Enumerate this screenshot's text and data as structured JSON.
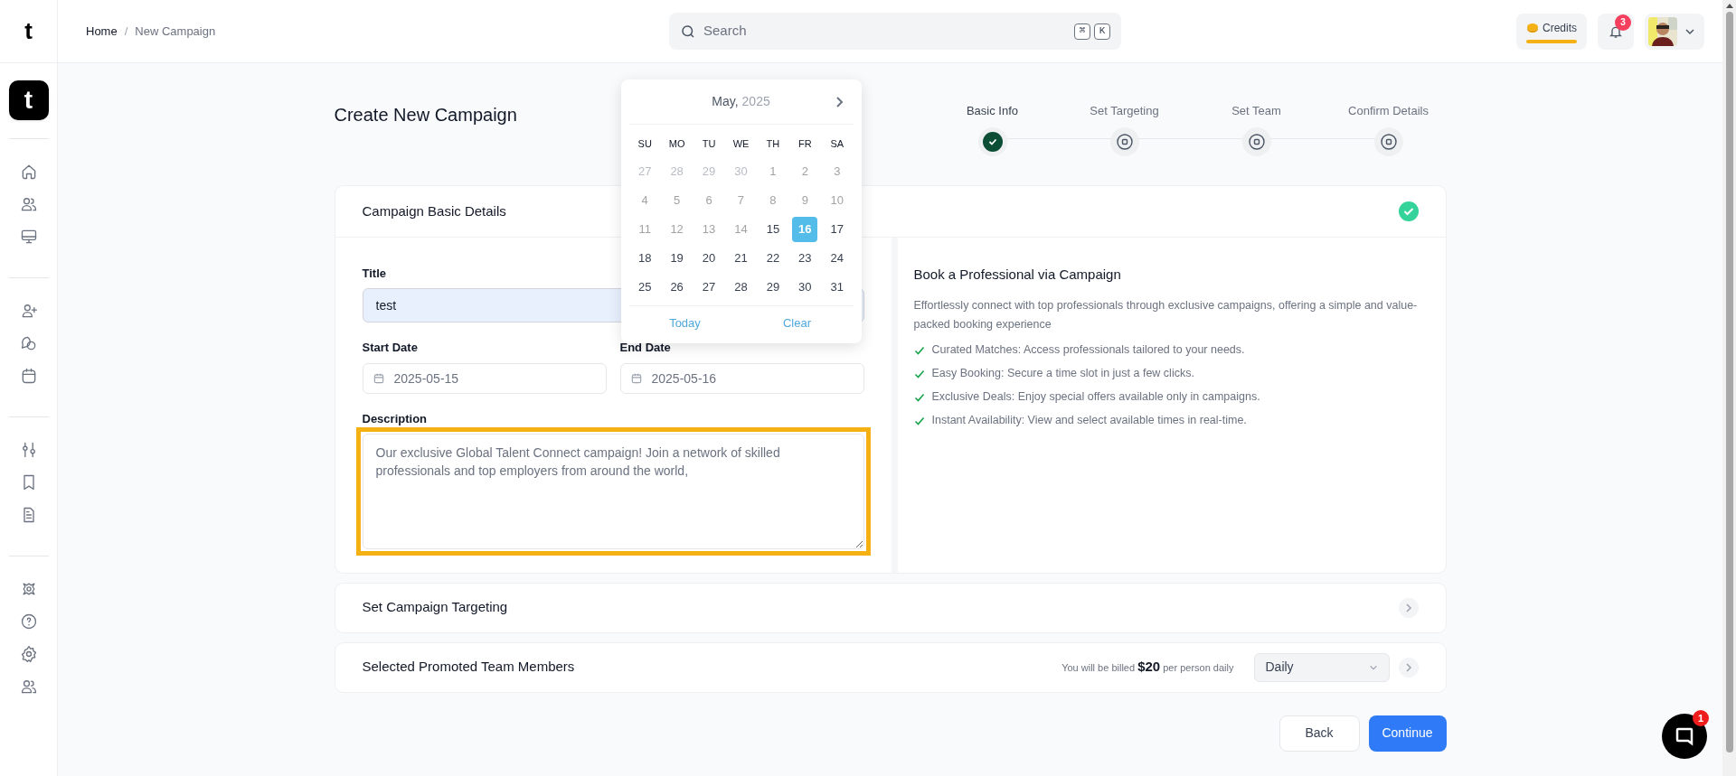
{
  "brand": {
    "logo_letter": "t",
    "app_letter": "t"
  },
  "breadcrumb": [
    {
      "label": "Home"
    },
    {
      "label": "New Campaign"
    }
  ],
  "breadcrumb_separator": "/",
  "search": {
    "placeholder": "Search",
    "keys": [
      "⌘",
      "K"
    ]
  },
  "credits": {
    "label": "Credits"
  },
  "notifications": {
    "count": "3"
  },
  "page_title": "Create New Campaign",
  "steps": [
    {
      "label": "Basic Info",
      "done": true
    },
    {
      "label": "Set Targeting",
      "done": false
    },
    {
      "label": "Set Team",
      "done": false
    },
    {
      "label": "Confirm Details",
      "done": false
    }
  ],
  "calendar": {
    "month": "May,",
    "year": "2025",
    "weekdays": [
      "SU",
      "MO",
      "TU",
      "WE",
      "TH",
      "FR",
      "SA"
    ],
    "days": [
      {
        "label": "27",
        "kind": "outside",
        "selected": false
      },
      {
        "label": "28",
        "kind": "outside",
        "selected": false
      },
      {
        "label": "29",
        "kind": "outside",
        "selected": false
      },
      {
        "label": "30",
        "kind": "outside",
        "selected": false
      },
      {
        "label": "1",
        "kind": "disabled",
        "selected": false
      },
      {
        "label": "2",
        "kind": "disabled",
        "selected": false
      },
      {
        "label": "3",
        "kind": "disabled",
        "selected": false
      },
      {
        "label": "4",
        "kind": "disabled",
        "selected": false
      },
      {
        "label": "5",
        "kind": "disabled",
        "selected": false
      },
      {
        "label": "6",
        "kind": "disabled",
        "selected": false
      },
      {
        "label": "7",
        "kind": "disabled",
        "selected": false
      },
      {
        "label": "8",
        "kind": "disabled",
        "selected": false
      },
      {
        "label": "9",
        "kind": "disabled",
        "selected": false
      },
      {
        "label": "10",
        "kind": "disabled",
        "selected": false
      },
      {
        "label": "11",
        "kind": "disabled",
        "selected": false
      },
      {
        "label": "12",
        "kind": "disabled",
        "selected": false
      },
      {
        "label": "13",
        "kind": "disabled",
        "selected": false
      },
      {
        "label": "14",
        "kind": "disabled",
        "selected": false
      },
      {
        "label": "15",
        "kind": "available",
        "selected": false
      },
      {
        "label": "16",
        "kind": "available",
        "selected": true
      },
      {
        "label": "17",
        "kind": "available",
        "selected": false
      },
      {
        "label": "18",
        "kind": "available",
        "selected": false
      },
      {
        "label": "19",
        "kind": "available",
        "selected": false
      },
      {
        "label": "20",
        "kind": "available",
        "selected": false
      },
      {
        "label": "21",
        "kind": "available",
        "selected": false
      },
      {
        "label": "22",
        "kind": "available",
        "selected": false
      },
      {
        "label": "23",
        "kind": "available",
        "selected": false
      },
      {
        "label": "24",
        "kind": "available",
        "selected": false
      },
      {
        "label": "25",
        "kind": "available",
        "selected": false
      },
      {
        "label": "26",
        "kind": "available",
        "selected": false
      },
      {
        "label": "27",
        "kind": "available",
        "selected": false
      },
      {
        "label": "28",
        "kind": "available",
        "selected": false
      },
      {
        "label": "29",
        "kind": "available",
        "selected": false
      },
      {
        "label": "30",
        "kind": "available",
        "selected": false
      },
      {
        "label": "31",
        "kind": "available",
        "selected": false
      }
    ],
    "actions": [
      "Today",
      "Clear"
    ]
  },
  "basic_details": {
    "title": "Campaign Basic Details",
    "complete": true,
    "title_field": {
      "label": "Title",
      "value": "test"
    },
    "start_date": {
      "label": "Start Date",
      "value": "2025-05-15"
    },
    "end_date": {
      "label": "End Date",
      "value": "2025-05-16"
    },
    "description": {
      "label": "Description",
      "value": "Our exclusive Global Talent Connect campaign! Join a network of skilled professionals and top employers from around the world,",
      "highlighted": true
    }
  },
  "info": {
    "title": "Book a Professional via Campaign",
    "text": "Effortlessly connect with top professionals through exclusive campaigns, offering a simple and value-packed booking experience",
    "bullets": [
      "Curated Matches: Access professionals tailored to your needs.",
      "Easy Booking: Secure a time slot in just a few clicks.",
      "Exclusive Deals: Enjoy special offers available only in campaigns.",
      "Instant Availability: View and select available times in real-time."
    ]
  },
  "targeting": {
    "title": "Set Campaign Targeting"
  },
  "team": {
    "title": "Selected Promoted Team Members",
    "billing": "You will be billed **$20** per person daily",
    "frequency": "Daily"
  },
  "buttons": {
    "back": "Back",
    "continue": "Continue"
  },
  "chat": {
    "badge": "1"
  }
}
